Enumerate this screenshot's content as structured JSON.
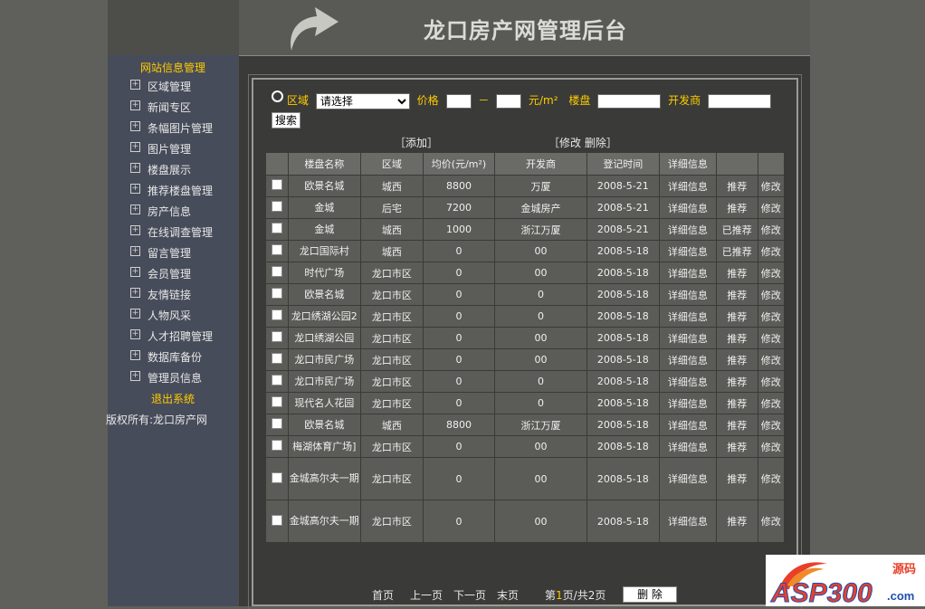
{
  "header": {
    "title": "龙口房产网管理后台"
  },
  "sidebar": {
    "group_title": "网站信息管理",
    "items": [
      "区域管理",
      "新闻专区",
      "条幅图片管理",
      "图片管理",
      "楼盘展示",
      "推荐楼盘管理",
      "房产信息",
      "在线调查管理",
      "留言管理",
      "会员管理",
      "友情链接",
      "人物风采",
      "人才招聘管理",
      "数据库备份",
      "管理员信息"
    ],
    "logout": "退出系统",
    "copyright": "版权所有:龙口房产网"
  },
  "search": {
    "area_label": "区域",
    "area_selected": "请选择",
    "price_label": "价格",
    "dash": "－",
    "unit": "元/m²",
    "estate_label": "楼盘",
    "developer_label": "开发商",
    "search_button": "搜索"
  },
  "actions": {
    "add": "［添加］",
    "edit_delete": "［修改  删除］"
  },
  "table": {
    "headers": [
      "",
      "楼盘名称",
      "区域",
      "均价(元/m²)",
      "开发商",
      "登记时间",
      "详细信息",
      "",
      ""
    ],
    "rows": [
      {
        "name": "欧景名城",
        "area": "城西",
        "price": "8800",
        "dev": "万厦",
        "date": "2008-5-21",
        "detail": "详细信息",
        "rec": "推荐",
        "recommended": false,
        "edit": "修改",
        "tall": false
      },
      {
        "name": "金城",
        "area": "后宅",
        "price": "7200",
        "dev": "金城房产",
        "date": "2008-5-21",
        "detail": "详细信息",
        "rec": "推荐",
        "recommended": false,
        "edit": "修改",
        "tall": false
      },
      {
        "name": "金城",
        "area": "城西",
        "price": "1000",
        "dev": "浙江万厦",
        "date": "2008-5-21",
        "detail": "详细信息",
        "rec": "已推荐",
        "recommended": true,
        "edit": "修改",
        "tall": false
      },
      {
        "name": "龙口国际村",
        "area": "城西",
        "price": "0",
        "dev": "00",
        "date": "2008-5-18",
        "detail": "详细信息",
        "rec": "已推荐",
        "recommended": true,
        "edit": "修改",
        "tall": false
      },
      {
        "name": "时代广场",
        "area": "龙口市区",
        "price": "0",
        "dev": "00",
        "date": "2008-5-18",
        "detail": "详细信息",
        "rec": "推荐",
        "recommended": false,
        "edit": "修改",
        "tall": false
      },
      {
        "name": "欧景名城",
        "area": "龙口市区",
        "price": "0",
        "dev": "0",
        "date": "2008-5-18",
        "detail": "详细信息",
        "rec": "推荐",
        "recommended": false,
        "edit": "修改",
        "tall": false
      },
      {
        "name": "龙口绣湖公园2",
        "area": "龙口市区",
        "price": "0",
        "dev": "0",
        "date": "2008-5-18",
        "detail": "详细信息",
        "rec": "推荐",
        "recommended": false,
        "edit": "修改",
        "tall": false
      },
      {
        "name": "龙口绣湖公园",
        "area": "龙口市区",
        "price": "0",
        "dev": "00",
        "date": "2008-5-18",
        "detail": "详细信息",
        "rec": "推荐",
        "recommended": false,
        "edit": "修改",
        "tall": false
      },
      {
        "name": "龙口市民广场",
        "area": "龙口市区",
        "price": "0",
        "dev": "00",
        "date": "2008-5-18",
        "detail": "详细信息",
        "rec": "推荐",
        "recommended": false,
        "edit": "修改",
        "tall": false
      },
      {
        "name": "龙口市民广场",
        "area": "龙口市区",
        "price": "0",
        "dev": "0",
        "date": "2008-5-18",
        "detail": "详细信息",
        "rec": "推荐",
        "recommended": false,
        "edit": "修改",
        "tall": false
      },
      {
        "name": "现代名人花园",
        "area": "龙口市区",
        "price": "0",
        "dev": "0",
        "date": "2008-5-18",
        "detail": "详细信息",
        "rec": "推荐",
        "recommended": false,
        "edit": "修改",
        "tall": false
      },
      {
        "name": "欧景名城",
        "area": "城西",
        "price": "8800",
        "dev": "浙江万厦",
        "date": "2008-5-18",
        "detail": "详细信息",
        "rec": "推荐",
        "recommended": false,
        "edit": "修改",
        "tall": false
      },
      {
        "name": "梅湖体育广场]",
        "area": "龙口市区",
        "price": "0",
        "dev": "00",
        "date": "2008-5-18",
        "detail": "详细信息",
        "rec": "推荐",
        "recommended": false,
        "edit": "修改",
        "tall": false
      },
      {
        "name": "金城高尔夫一期",
        "area": "龙口市区",
        "price": "0",
        "dev": "00",
        "date": "2008-5-18",
        "detail": "详细信息",
        "rec": "推荐",
        "recommended": false,
        "edit": "修改",
        "tall": true
      },
      {
        "name": "金城高尔夫一期",
        "area": "龙口市区",
        "price": "0",
        "dev": "00",
        "date": "2008-5-18",
        "detail": "详细信息",
        "rec": "推荐",
        "recommended": false,
        "edit": "修改",
        "tall": true
      }
    ]
  },
  "pager": {
    "first": "首页",
    "prev": "上一页",
    "next": "下一页",
    "last": "末页",
    "page_prefix": "第",
    "page_current": "1",
    "page_suffix": "页/共2页",
    "delete_button": "删 除"
  },
  "logo": {
    "text": "ASP300",
    "sub": "源码",
    "domain": ".com"
  },
  "colors": {
    "accent": "#ffcc00",
    "logo_red": "#e8402a",
    "logo_blue": "#1e4fb0"
  }
}
